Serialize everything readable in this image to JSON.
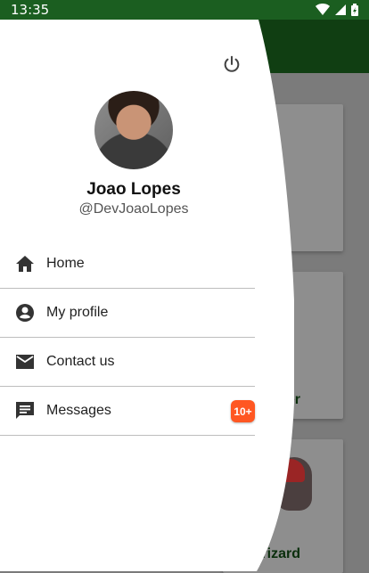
{
  "status_bar": {
    "time": "13:35"
  },
  "profile": {
    "name": "Joao Lopes",
    "handle": "@DevJoaoLopes"
  },
  "menu": {
    "items": [
      {
        "label": "Home",
        "icon": "home-icon"
      },
      {
        "label": "My profile",
        "icon": "account-circle-icon"
      },
      {
        "label": "Contact us",
        "icon": "mail-icon"
      },
      {
        "label": "Messages",
        "icon": "chat-icon",
        "badge": "10+"
      }
    ]
  },
  "background_cards": [
    {
      "label": ""
    },
    {
      "label": "der"
    },
    {
      "label": "rizard"
    }
  ],
  "colors": {
    "status_bar": "#1b5e20",
    "app_bar": "#103e12",
    "badge": "#ff5722",
    "card_text": "#0a2e0c"
  }
}
